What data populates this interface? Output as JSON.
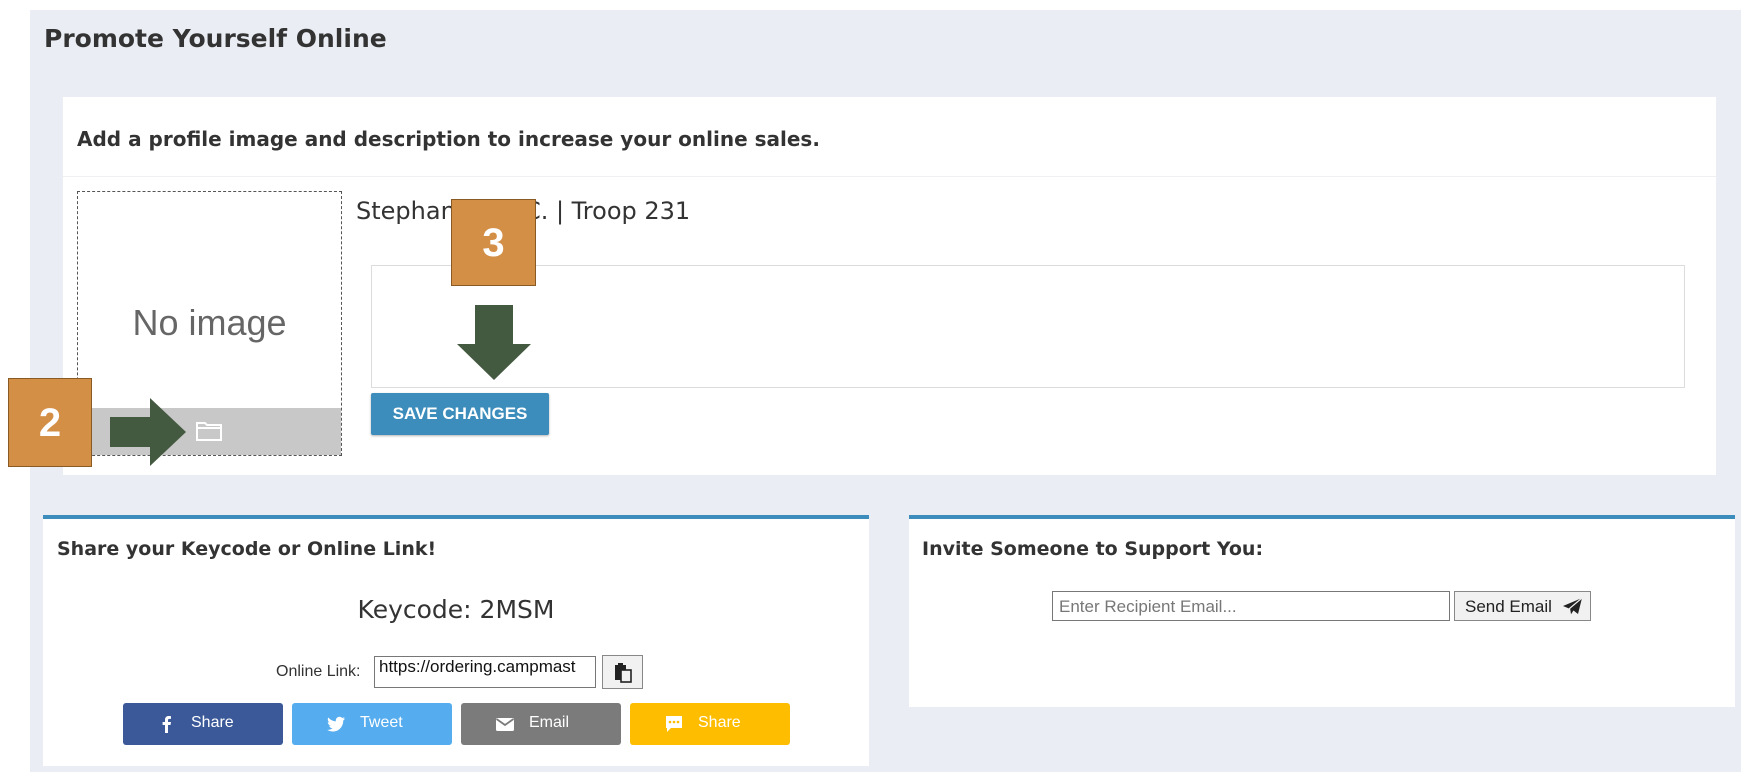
{
  "page": {
    "title": "Promote Yourself Online"
  },
  "profile": {
    "header": "Add a profile image and description to increase your online sales.",
    "no_image": "No image",
    "name": "Stephan      e C. | Troop 231",
    "save_label": "SAVE CHANGES"
  },
  "callouts": {
    "two": "2",
    "three": "3"
  },
  "share": {
    "header": "Share your Keycode or Online Link!",
    "keycode": "Keycode: 2MSM",
    "online_link_label": "Online Link:",
    "online_link_value": "https://ordering.campmast",
    "buttons": [
      {
        "label": "Share",
        "icon": "facebook-icon",
        "color": "#3b5998"
      },
      {
        "label": "Tweet",
        "icon": "twitter-icon",
        "color": "#55acee"
      },
      {
        "label": "Email",
        "icon": "envelope-icon",
        "color": "#7b7b7b"
      },
      {
        "label": "Share",
        "icon": "sms-icon",
        "color": "#ffbd00"
      }
    ]
  },
  "invite": {
    "header": "Invite Someone to Support You:",
    "placeholder": "Enter Recipient Email...",
    "send_label": "Send Email"
  },
  "colors": {
    "accent": "#3c8dbc",
    "callout": "#d48f47",
    "arrow": "#445a40",
    "background": "#eaeef4"
  }
}
